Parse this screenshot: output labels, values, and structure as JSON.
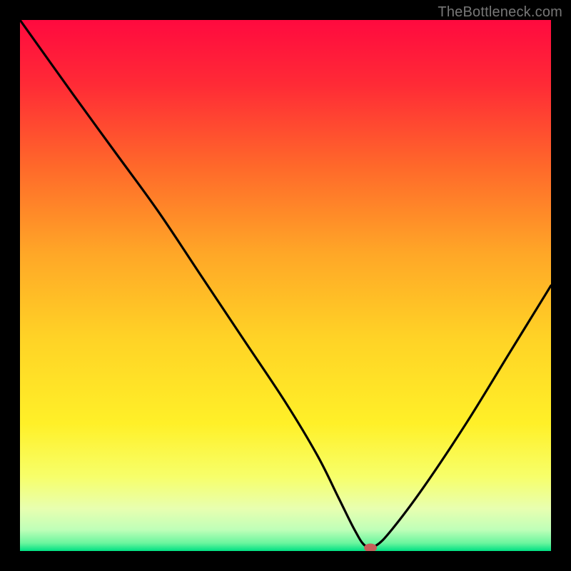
{
  "attribution": "TheBottleneck.com",
  "chart_data": {
    "type": "line",
    "title": "",
    "xlabel": "",
    "ylabel": "",
    "xlim": [
      0,
      100
    ],
    "ylim": [
      0,
      100
    ],
    "grid": false,
    "legend": false,
    "annotations": [],
    "background": {
      "type": "vertical-gradient",
      "stops": [
        {
          "pos": 0.0,
          "color": "#ff0a3f"
        },
        {
          "pos": 0.12,
          "color": "#ff2a36"
        },
        {
          "pos": 0.28,
          "color": "#ff6a2a"
        },
        {
          "pos": 0.44,
          "color": "#ffa727"
        },
        {
          "pos": 0.6,
          "color": "#ffd326"
        },
        {
          "pos": 0.76,
          "color": "#fff028"
        },
        {
          "pos": 0.86,
          "color": "#f7ff6a"
        },
        {
          "pos": 0.92,
          "color": "#e8ffb0"
        },
        {
          "pos": 0.96,
          "color": "#bfffb8"
        },
        {
          "pos": 0.985,
          "color": "#6bf59e"
        },
        {
          "pos": 1.0,
          "color": "#00e083"
        }
      ]
    },
    "series": [
      {
        "name": "bottleneck-curve",
        "color": "#000000",
        "x": [
          0,
          10,
          18,
          26,
          34,
          42,
          50,
          56,
          60,
          63,
          65,
          67,
          70,
          76,
          84,
          92,
          100
        ],
        "values": [
          100,
          86,
          75,
          64,
          52,
          40,
          28,
          18,
          10,
          4,
          1,
          1,
          4,
          12,
          24,
          37,
          50
        ]
      }
    ],
    "marker": {
      "name": "optimal-point",
      "x": 66,
      "y": 0.6,
      "color": "#c6605a",
      "rx": 9,
      "ry": 6
    }
  }
}
